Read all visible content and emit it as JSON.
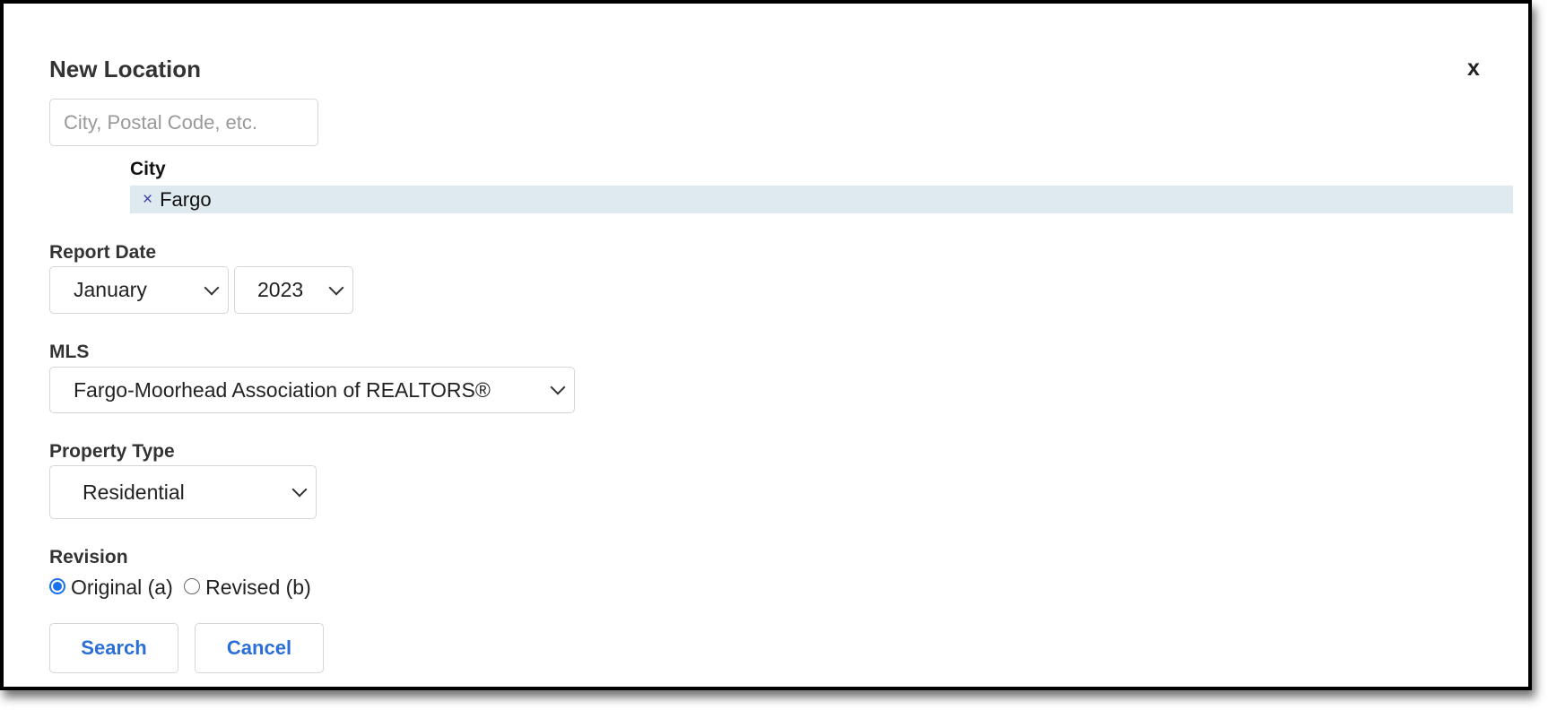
{
  "dialog": {
    "title": "New Location",
    "close_label": "x",
    "search": {
      "placeholder": "City, Postal Code, etc.",
      "value": ""
    },
    "selected_group": {
      "label": "City",
      "items": [
        {
          "remove_icon": "×",
          "label": "Fargo"
        }
      ]
    },
    "report_date": {
      "label": "Report Date",
      "month": "January",
      "year": "2023"
    },
    "mls": {
      "label": "MLS",
      "value": "Fargo-Moorhead Association of REALTORS®"
    },
    "property_type": {
      "label": "Property Type",
      "value": "Residential"
    },
    "revision": {
      "label": "Revision",
      "options": [
        {
          "label": "Original (a)",
          "checked": true
        },
        {
          "label": "Revised (b)",
          "checked": false
        }
      ]
    },
    "buttons": {
      "search": "Search",
      "cancel": "Cancel"
    },
    "colors": {
      "accent": "#2a6fd6",
      "chip_bg": "#dfeaf0"
    }
  }
}
